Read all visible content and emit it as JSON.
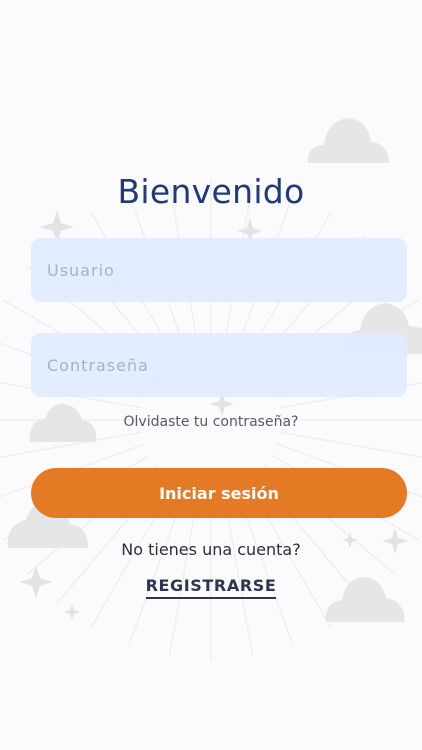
{
  "login": {
    "title": "Bienvenido",
    "username_placeholder": "Usuario",
    "password_placeholder": "Contraseña",
    "forgot_password": "Olvidaste tu contraseña?",
    "login_button": "Iniciar sesión",
    "no_account": "No tienes una cuenta?",
    "register_link": "REGISTRARSE"
  },
  "colors": {
    "accent": "#e57a24",
    "title": "#1f3a7a",
    "input_bg": "#e0ebff",
    "background": "#fbfafc"
  }
}
